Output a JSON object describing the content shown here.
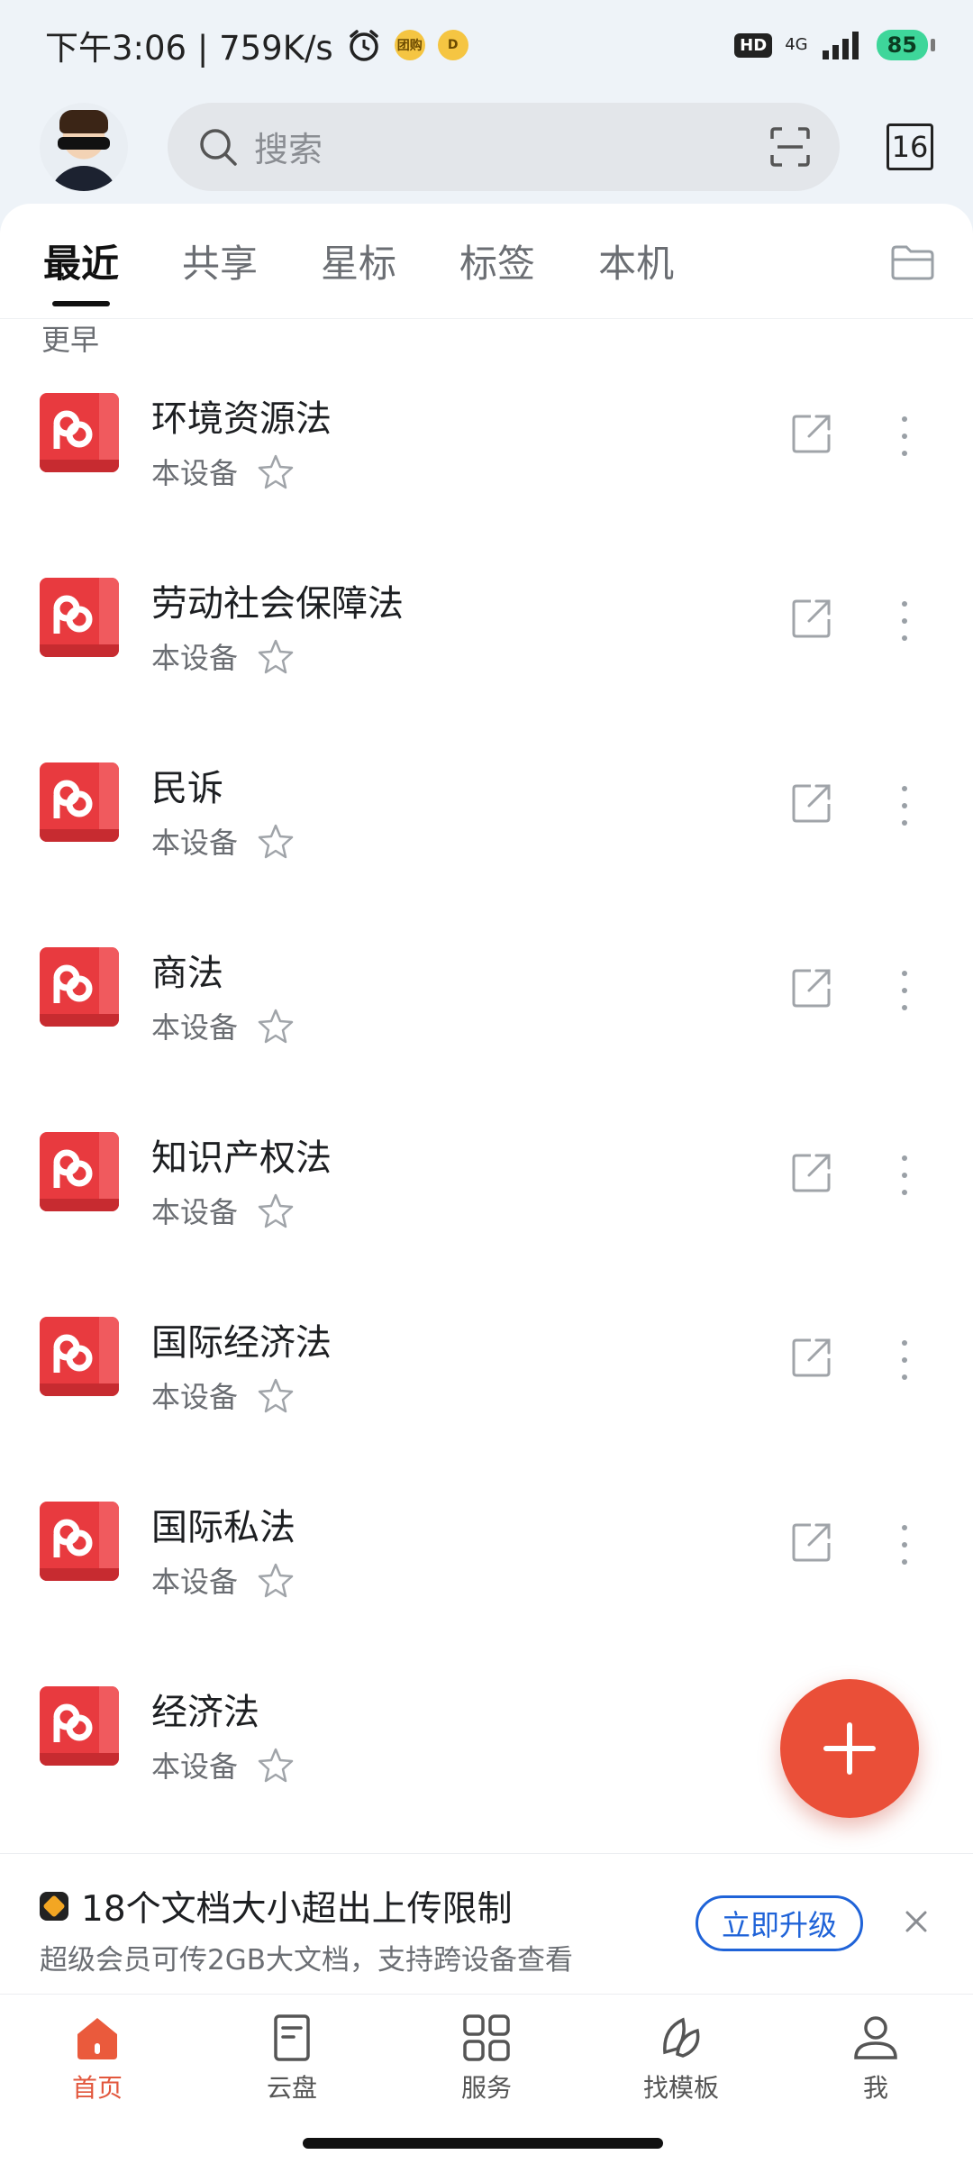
{
  "status_bar": {
    "time_speed": "下午3:06 | 759K/s",
    "hd": "HD",
    "network": "4G",
    "battery": "85",
    "mini_icon_1": "团购",
    "mini_icon_2": "D"
  },
  "header": {
    "search_placeholder": "搜索",
    "calendar_day": "16"
  },
  "tabs": [
    "最近",
    "共享",
    "星标",
    "标签",
    "本机"
  ],
  "section_label": "更早",
  "files": [
    {
      "name": "环境资源法",
      "location": "本设备"
    },
    {
      "name": "劳动社会保障法",
      "location": "本设备"
    },
    {
      "name": "民诉",
      "location": "本设备"
    },
    {
      "name": "商法",
      "location": "本设备"
    },
    {
      "name": "知识产权法",
      "location": "本设备"
    },
    {
      "name": "国际经济法",
      "location": "本设备"
    },
    {
      "name": "国际私法",
      "location": "本设备"
    },
    {
      "name": "经济法",
      "location": "本设备"
    }
  ],
  "banner": {
    "title": "18个文档大小超出上传限制",
    "subtitle": "超级会员可传2GB大文档，支持跨设备查看",
    "upgrade_label": "立即升级"
  },
  "bottom_nav": [
    {
      "label": "首页",
      "icon": "home-icon",
      "active": true
    },
    {
      "label": "云盘",
      "icon": "cloud-disk-icon",
      "active": false
    },
    {
      "label": "服务",
      "icon": "services-grid-icon",
      "active": false
    },
    {
      "label": "找模板",
      "icon": "template-leaf-icon",
      "active": false
    },
    {
      "label": "我",
      "icon": "profile-icon",
      "active": false
    }
  ],
  "colors": {
    "accent": "#e2573d",
    "pdf_red": "#e83a3f",
    "upgrade_blue": "#1f63d8",
    "background": "#eef3f8"
  }
}
